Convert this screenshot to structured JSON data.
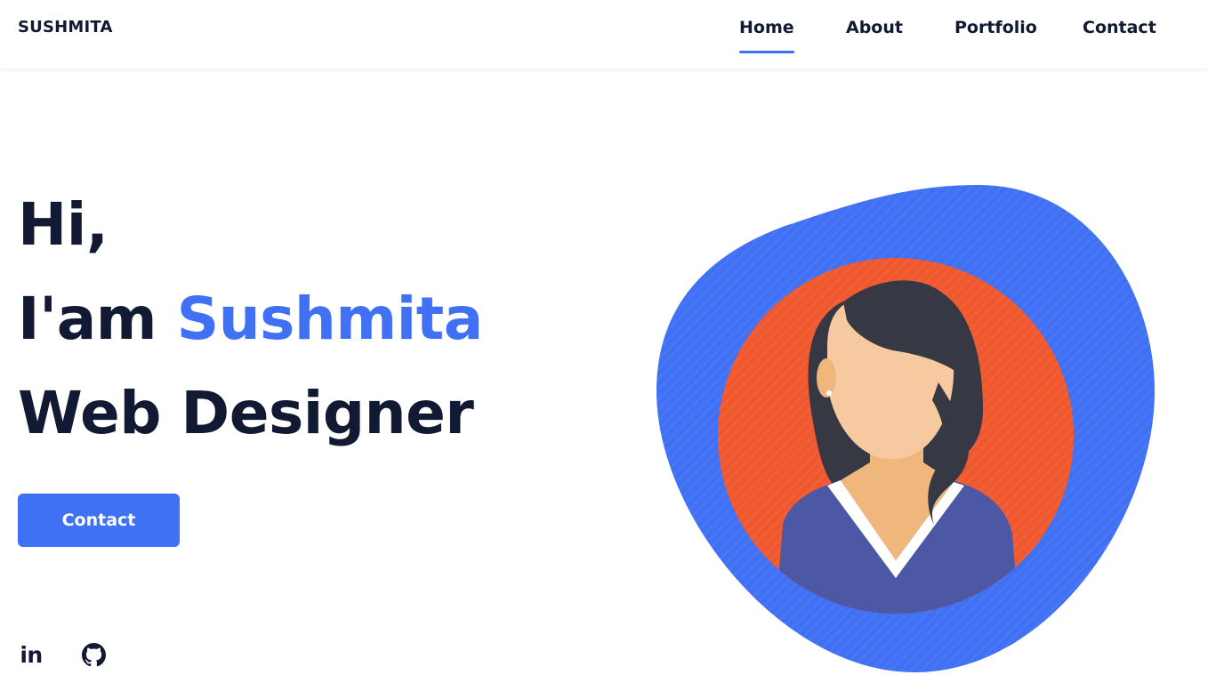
{
  "header": {
    "logo": "SUSHMITA",
    "nav": [
      {
        "label": "Home",
        "active": true
      },
      {
        "label": "About",
        "active": false
      },
      {
        "label": "Portfolio",
        "active": false
      },
      {
        "label": "Contact",
        "active": false
      }
    ]
  },
  "hero": {
    "greeting": "Hi,",
    "intro_prefix": "I'am",
    "name": "Sushmita",
    "role": "Web Designer",
    "cta_label": "Contact"
  },
  "social": {
    "linkedin_text": "in",
    "icons": [
      "linkedin-icon",
      "github-icon"
    ]
  },
  "colors": {
    "accent": "#4070f4",
    "text_dark": "#121933",
    "blob": "#4070f4",
    "circle": "#f0582f",
    "hair": "#363843",
    "skin": "#f7c9a0",
    "shirt": "#4c58a4"
  }
}
